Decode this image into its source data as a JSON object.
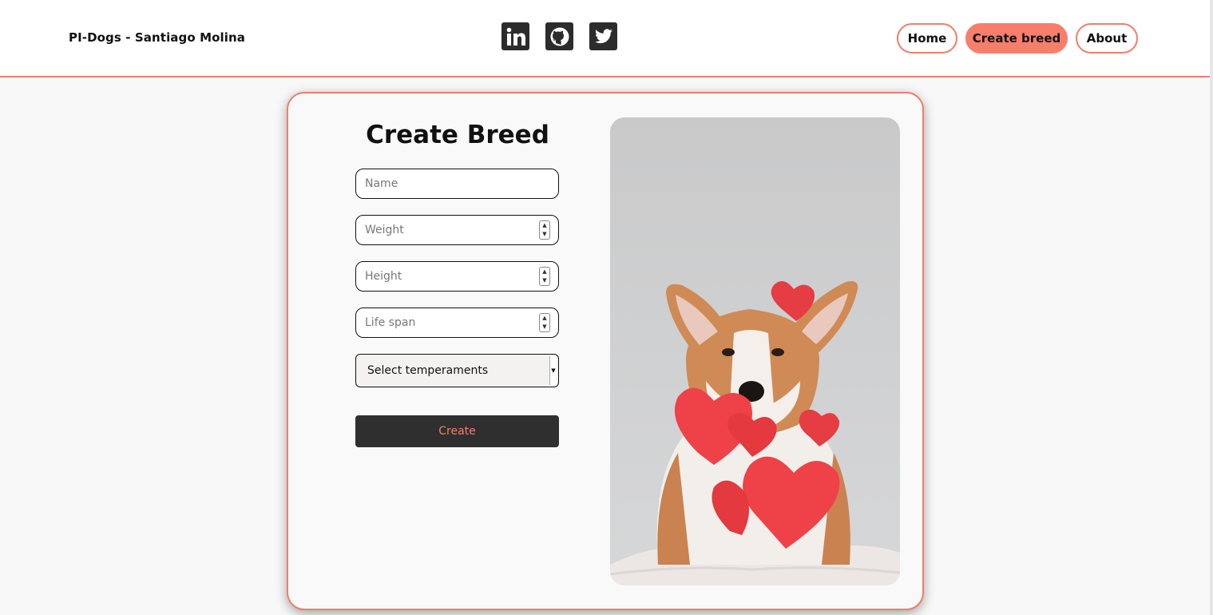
{
  "header": {
    "brand": "PI-Dogs - Santiago Molina",
    "socials": [
      {
        "icon": "linkedin-icon"
      },
      {
        "icon": "github-icon"
      },
      {
        "icon": "twitter-icon"
      }
    ],
    "nav": {
      "home": "Home",
      "create_breed": "Create breed",
      "about": "About"
    }
  },
  "form": {
    "title": "Create Breed",
    "name_placeholder": "Name",
    "weight_placeholder": "Weight",
    "height_placeholder": "Height",
    "life_span_placeholder": "Life span",
    "temperaments_selected": "Select temperaments",
    "submit_label": "Create"
  },
  "image": {
    "subject": "corgi-with-paper-hearts"
  },
  "colors": {
    "accent": "#f87e6c",
    "dark_button": "#2f2f2f",
    "background": "#f8f8f8"
  }
}
